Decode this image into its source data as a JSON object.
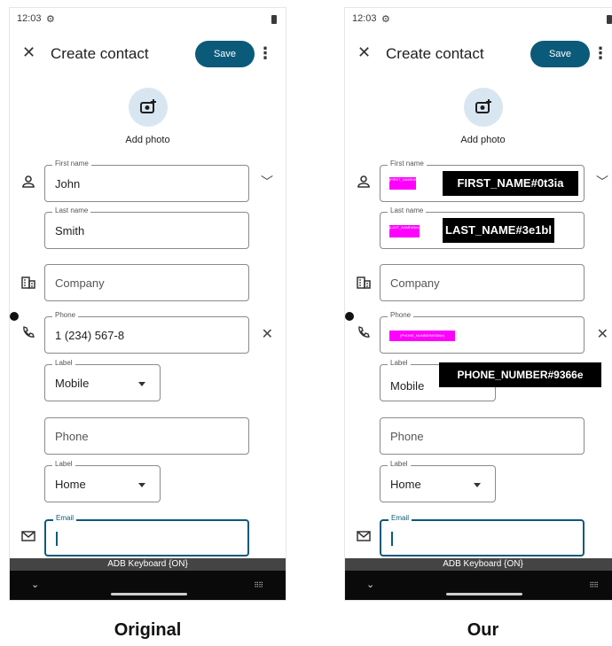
{
  "status": {
    "time": "12:03"
  },
  "appbar": {
    "title": "Create contact",
    "save_label": "Save"
  },
  "photo": {
    "label": "Add photo"
  },
  "fields": {
    "first_name": {
      "label": "First name",
      "value": "John"
    },
    "last_name": {
      "label": "Last name",
      "value": "Smith"
    },
    "company": {
      "placeholder": "Company"
    },
    "phone": {
      "label": "Phone",
      "value": "1 (234) 567-8"
    },
    "phone_label": {
      "label": "Label",
      "value": "Mobile"
    },
    "phone2": {
      "placeholder": "Phone"
    },
    "phone2_label": {
      "label": "Label",
      "value": "Home"
    },
    "email": {
      "label": "Email",
      "value": ""
    }
  },
  "keyboard_banner": "ADB Keyboard {ON}",
  "redactions": {
    "first_name_tag": "FIRST_NAME#0t3ia",
    "last_name_tag": "LAST_NAME#3e1bl",
    "phone_tag": "PHONE_NUMBER#9366e",
    "first_name_small": "[FIRST_NAME#0t3ia]",
    "last_name_small": "[LAST_NAME#3e1bl]",
    "phone_small": "[PHONE_NUMBER#9366e]"
  },
  "captions": {
    "left": "Original",
    "right": "Our"
  },
  "colors": {
    "accent": "#0b5a7a",
    "redaction": "#ff00ff"
  },
  "icons": [
    "gear-icon",
    "battery-icon",
    "close-icon",
    "more-vert-icon",
    "add-photo-icon",
    "person-icon",
    "chevron-down-icon",
    "business-icon",
    "phone-icon",
    "clear-icon",
    "dropdown-arrow-icon",
    "email-icon",
    "keyboard-hide-icon",
    "keyboard-icon"
  ]
}
